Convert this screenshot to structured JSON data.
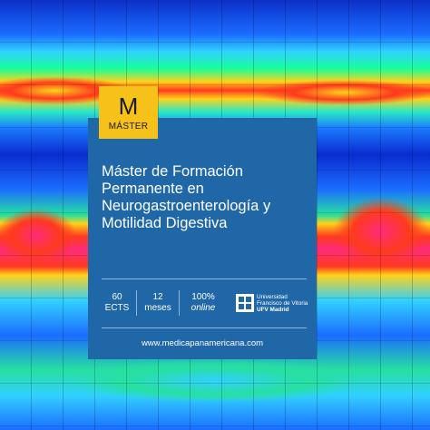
{
  "badge": {
    "letter": "M",
    "label": "MÁSTER"
  },
  "title_lines": [
    "Máster de Formación",
    "Permanente en",
    "Neurogastroenterología y",
    "Motilidad Digestiva"
  ],
  "stats": [
    {
      "value": "60",
      "unit": "ECTS"
    },
    {
      "value": "12",
      "unit": "meses"
    },
    {
      "value": "100%",
      "unit": "online"
    }
  ],
  "university": {
    "line1": "Universidad",
    "line2": "Francisco de Vitoria",
    "line3": "UFV Madrid"
  },
  "url": "www.medicapanamericana.com",
  "colors": {
    "card": "#1f67a7",
    "badge": "#f6c21a"
  }
}
